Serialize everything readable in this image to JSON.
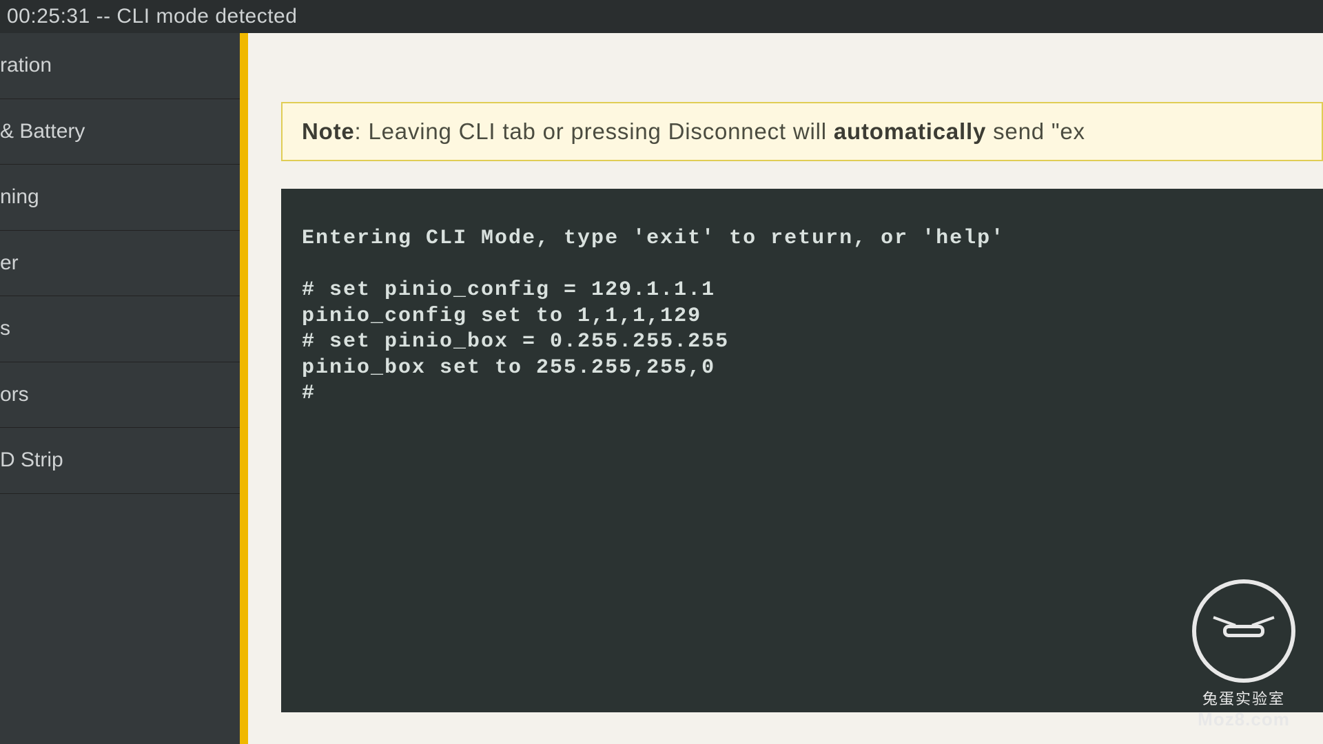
{
  "topbar": {
    "logline": "00:25:31 -- CLI mode detected"
  },
  "sidebar": {
    "items": [
      {
        "label": "ration"
      },
      {
        "label": "& Battery"
      },
      {
        "label": "ning"
      },
      {
        "label": "er"
      },
      {
        "label": "s"
      },
      {
        "label": "ors"
      },
      {
        "label": "D Strip"
      }
    ]
  },
  "note": {
    "prefix": "Note",
    "middle": ": Leaving CLI tab or pressing Disconnect will ",
    "bold": "automatically",
    "tail": " send \"ex"
  },
  "cli": {
    "entry": "Entering CLI Mode, type 'exit' to return, or 'help'",
    "blank": "",
    "l1": "# set pinio_config = 129.1.1.1",
    "l2": "pinio_config set to 1,1,1,129",
    "l3": "# set pinio_box = 0.255.255.255",
    "l4": "pinio_box set to 255.255,255,0",
    "l5": "#"
  },
  "watermark": {
    "line1": "兔蛋实验室",
    "line2": "Moz8.com"
  }
}
